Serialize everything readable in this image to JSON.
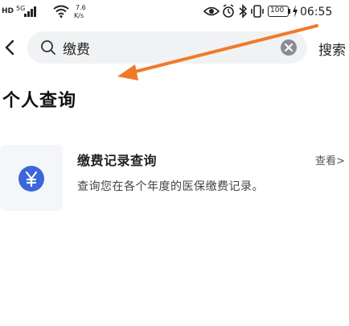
{
  "status_bar": {
    "hd_label": "HD",
    "network_label": "5G",
    "speed_value": "7.6",
    "speed_unit": "K/s",
    "battery_level": "100",
    "time": "06:55"
  },
  "search": {
    "value": "缴费",
    "action_label": "搜索"
  },
  "section": {
    "title": "个人查询"
  },
  "result_card": {
    "title": "缴费记录查询",
    "description": "查询您在各个年度的医保缴费记录。",
    "link_label": "查看>"
  },
  "colors": {
    "accent_blue": "#3b67d9",
    "annotation_orange": "#f07a2a",
    "search_bg": "#f1f2f4"
  },
  "icons": {
    "back": "chevron-left-icon",
    "search": "search-icon",
    "clear": "clear-icon",
    "result": "yen-icon"
  }
}
